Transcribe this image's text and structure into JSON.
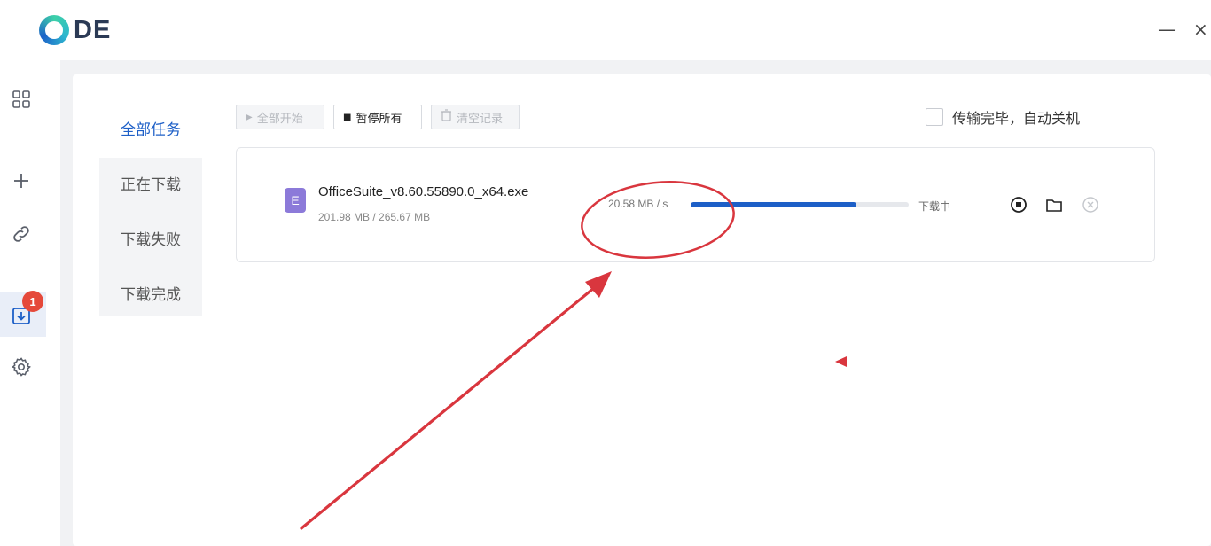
{
  "app": {
    "logo_text": "DE",
    "minimize_glyph": "—",
    "close_glyph": "×"
  },
  "rail": {
    "items": [
      {
        "icon": "grid-icon"
      },
      {
        "icon": "plus-icon"
      },
      {
        "icon": "link-icon"
      },
      {
        "icon": "download-box-icon",
        "badge": "1",
        "active": true
      },
      {
        "icon": "gear-icon"
      }
    ]
  },
  "categories": [
    {
      "label": "全部任务",
      "active": true
    },
    {
      "label": "正在下载"
    },
    {
      "label": "下载失败"
    },
    {
      "label": "下载完成"
    }
  ],
  "toolbar": {
    "start_all": "全部开始",
    "pause_all": "暂停所有",
    "clear_records": "清空记录",
    "start_icon": "play-icon",
    "pause_icon": "stop-square-icon",
    "clear_icon": "trash-icon"
  },
  "shutdown_option": {
    "label": "传输完毕，自动关机",
    "checked": false
  },
  "task": {
    "file_icon_letter": "E",
    "file_name": "OfficeSuite_v8.60.55890.0_x64.exe",
    "size_text": "201.98 MB / 265.67 MB",
    "speed": "20.58 MB / s",
    "progress": 0.76,
    "status": "下载中",
    "actions": [
      "stop-circle-icon",
      "folder-icon",
      "cancel-circle-icon"
    ]
  },
  "colors": {
    "accent": "#1d5fc7",
    "badge": "#e5493a",
    "annotation": "#d9363e",
    "file_icon": "#8c7ad9"
  }
}
